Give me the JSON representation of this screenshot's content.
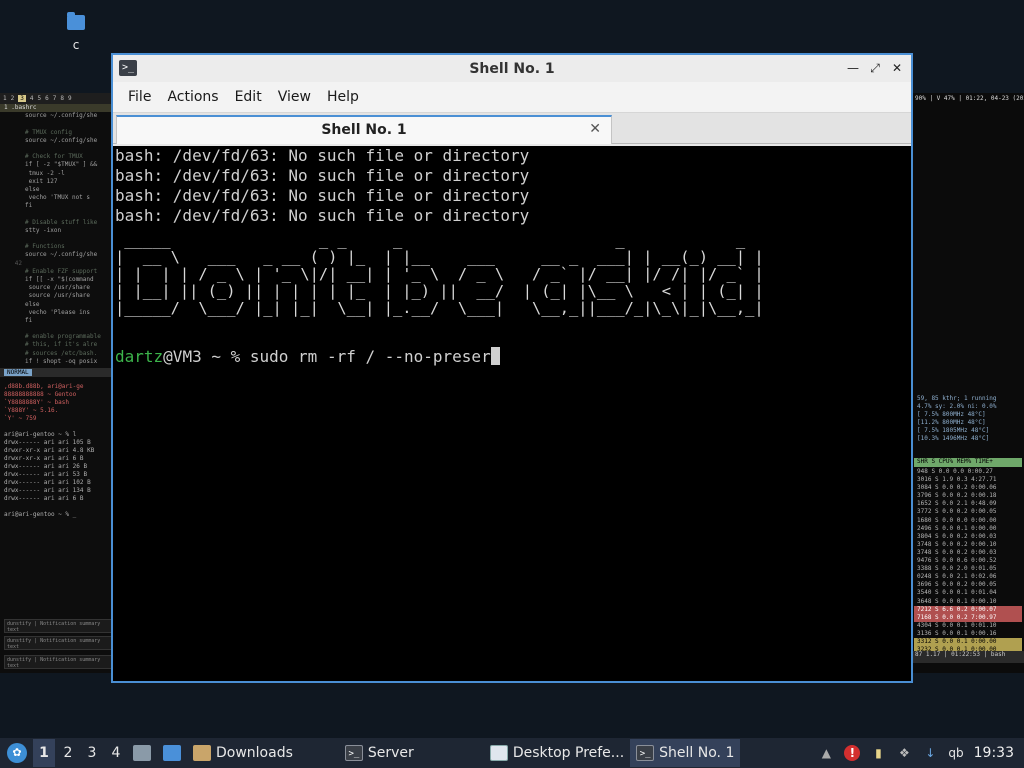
{
  "desktop": {
    "icon_label": "c"
  },
  "bg_left": {
    "tabs": [
      "1",
      "2",
      "3",
      "4",
      "5",
      "6",
      "7",
      "8",
      "9"
    ],
    "active_tab_index": 2,
    "file_tab": "1 .bashrc",
    "code_lines": [
      {
        "n": "",
        "t": "source ~/.config/she"
      },
      {
        "n": "",
        "t": ""
      },
      {
        "n": "",
        "t": "# TMUX config"
      },
      {
        "n": "",
        "t": "source ~/.config/she"
      },
      {
        "n": "",
        "t": ""
      },
      {
        "n": "",
        "t": "# Check for TMUX"
      },
      {
        "n": "",
        "t": "if [ -z \"$TMUX\" ] &&"
      },
      {
        "n": "",
        "t": "    tmux -2 -l"
      },
      {
        "n": "",
        "t": "    exit 127"
      },
      {
        "n": "",
        "t": "else"
      },
      {
        "n": "",
        "t": "    vecho 'TMUX not s"
      },
      {
        "n": "",
        "t": "fi"
      },
      {
        "n": "",
        "t": ""
      },
      {
        "n": "",
        "t": "# Disable stuff like"
      },
      {
        "n": "",
        "t": "stty -ixon"
      },
      {
        "n": "",
        "t": ""
      },
      {
        "n": "",
        "t": "# Functions"
      },
      {
        "n": "",
        "t": "source ~/.config/she"
      },
      {
        "n": "42",
        "t": ""
      },
      {
        "n": "",
        "t": "# Enable FZF support"
      },
      {
        "n": "",
        "t": "if [[ -x \"$(command"
      },
      {
        "n": "",
        "t": "    source /usr/share"
      },
      {
        "n": "",
        "t": "    source /usr/share"
      },
      {
        "n": "",
        "t": "else"
      },
      {
        "n": "",
        "t": "    vecho 'Please ins"
      },
      {
        "n": "",
        "t": "fi"
      },
      {
        "n": "",
        "t": ""
      },
      {
        "n": "",
        "t": "# enable programmable"
      },
      {
        "n": "",
        "t": "# this, if it's alre"
      },
      {
        "n": "",
        "t": "# sources /etc/bash."
      },
      {
        "n": "",
        "t": "if ! shopt -oq posix"
      }
    ],
    "mode": "NORMAL",
    "fetch": [
      ",d88b.d88b,    ari@ari-ge",
      "88888888888    ~ Gentoo",
      " `Y8888888Y'   ~ bash",
      "   `Y888Y'     ~ 5.16.",
      "     `Y'       ~ 759"
    ],
    "prompt1": "ari@ari-gentoo ~ % l",
    "ls": [
      "drwx------ ari ari 105 B",
      "drwxr-xr-x ari ari 4.8 KB",
      "drwxr-xr-x ari ari   6 B",
      "drwx------ ari ari  26 B",
      "drwx------ ari ari  53 B",
      "drwx------ ari ari 102 B",
      "drwx------ ari ari 134 B",
      "drwx------ ari ari   6 B"
    ],
    "prompt2": "ari@ari-gentoo ~ % _",
    "notifs": [
      "dunstify | Notification summary text",
      "dunstify | Notification summary text",
      "dunstify | Notification summary text"
    ]
  },
  "bg_right": {
    "top": "90% | V 47% | 01:22, 04-23 (2022)",
    "summary": "59, 85 kthr; 1 running",
    "summary2": "4.7% sy: 2.0% ni: 0.0%",
    "meters": [
      "[  7.5% 800MHz 48°C]",
      "[11.2% 800MHz 48°C]",
      "[ 7.5% 1805MHz 48°C]",
      "[10.3% 1496MHz 48°C]"
    ],
    "header": "SHR S CPU% MEM%  TIME+",
    "rows": [
      "948 S  0.0  0.0  0:00.27",
      "3016 S  1.9  0.3  4:27.71",
      "3084 S  0.0  0.2  0:00.06",
      "3796 S  0.0  0.2  0:00.18",
      "1652 S  0.0  2.1  0:48.09",
      "3772 S  0.0  0.2  0:00.05",
      "1680 S  0.0  0.0  0:00.00",
      "2496 S  0.0  0.1  0:00.00",
      "3804 S  0.0  0.2  0:00.03",
      "3748 S  0.0  0.2  0:00.10",
      "3748 S  0.0  0.2  0:00.03",
      "9476 S  0.0  0.6  0:00.52",
      "3388 S  0.0  2.0  0:01.05",
      "0248 S  0.0  2.1  0:02.06",
      "3696 S  0.0  0.2  0:00.05",
      "3540 S  0.0  0.1  0:01.04",
      "3648 S  0.0  0.1  0:00.10",
      "7212 S  6.6  0.2  0:00.07",
      "7168 S  0.0  0.2  7:00.97",
      "4304 S  0.0  0.1  0:01.10",
      "3136 S  0.0  0.1  0:00.16",
      "3312 S  0.0  0.1  0:00.00",
      "3232 S  0.0  0.1  0:00.00"
    ],
    "footer": "87 1.17 | 01:22:53 | bash"
  },
  "window": {
    "title": "Shell No. 1",
    "menu": [
      "File",
      "Actions",
      "Edit",
      "View",
      "Help"
    ],
    "tab_label": "Shell No. 1",
    "terminal": {
      "errors": [
        "bash: /dev/fd/63: No such file or directory",
        "bash: /dev/fd/63: No such file or directory",
        "bash: /dev/fd/63: No such file or directory",
        "bash: /dev/fd/63: No such file or directory"
      ],
      "art": [
        " _____                _ _     _                       _            _ ",
        "|  __ \\   ___   _ __ ( ) |_  | |__    ___     __ _  ___| | __(_) __| |",
        "| |  | | / _ \\ | '_ \\|/| __| | '_ \\  / _ \\   / _` |/ __| |/ /| |/ _` |",
        "| |__| || (_) || | | | | |_  | |_) ||  __/  | (_| |\\__ \\   < | | (_| |",
        "|_____/  \\___/ |_| |_|  \\__| |_.__/  \\___|   \\__,_||___/_|\\_\\|_|\\__,_|"
      ],
      "prompt_user": "dartz",
      "prompt_rest": "@VM3 ~ % ",
      "command": "sudo rm -rf / --no-preser"
    }
  },
  "taskbar": {
    "workspaces": [
      "1",
      "2",
      "3",
      "4"
    ],
    "active_workspace": "1",
    "tasks": [
      {
        "label": "Downloads",
        "icon": "folder-icon"
      },
      {
        "label": "Server",
        "icon": "terminal-icon"
      },
      {
        "label": "Desktop Prefe...",
        "icon": "window-icon"
      },
      {
        "label": "Shell No. 1",
        "icon": "terminal-icon"
      }
    ],
    "tray_text": "qb",
    "clock": "19:33"
  }
}
